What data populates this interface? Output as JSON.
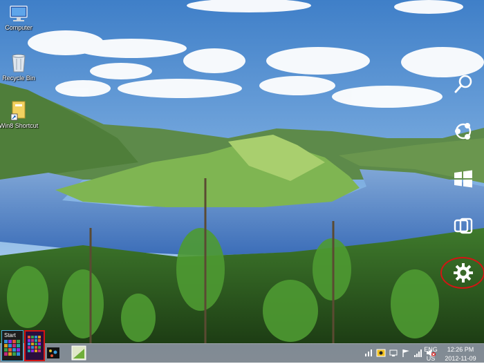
{
  "desktop": {
    "icons": [
      {
        "label": "Computer"
      },
      {
        "label": "Recycle Bin"
      },
      {
        "label": "Win8 Shortcut"
      }
    ]
  },
  "charms": [
    "search-icon",
    "share-icon",
    "start-icon",
    "devices-icon",
    "settings-icon"
  ],
  "start_thumbnail": {
    "label": "Start"
  },
  "taskbar": {
    "language": {
      "line1": "ENG",
      "line2": "US"
    },
    "clock": {
      "time": "12:26 PM",
      "date": "2012-11-09"
    }
  },
  "colors": {
    "highlight": "#d41414",
    "taskbar": "#464646"
  }
}
